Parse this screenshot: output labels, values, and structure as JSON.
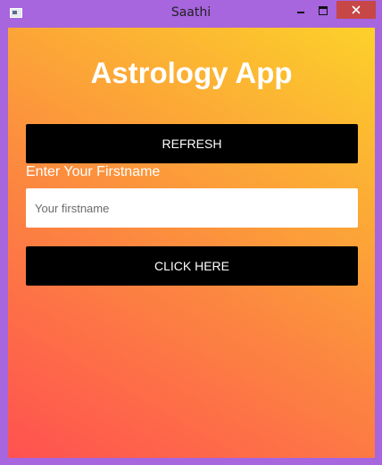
{
  "window": {
    "title": "Saathi",
    "icons": {
      "app": "app-window-icon",
      "minimize": "minimize-icon",
      "maximize": "maximize-icon",
      "close": "close-icon"
    }
  },
  "app": {
    "heading": "Astrology App",
    "refresh_label": "REFRESH",
    "firstname_label": "Enter Your Firstname",
    "firstname_value": "",
    "firstname_placeholder": "Your firstname",
    "submit_label": "CLICK HERE"
  },
  "colors": {
    "window_frame": "#a765de",
    "gradient_start": "#ff5150",
    "gradient_mid": "#fc8840",
    "gradient_end": "#fcd12a",
    "button_bg": "#000000",
    "close_button": "#c74646"
  }
}
